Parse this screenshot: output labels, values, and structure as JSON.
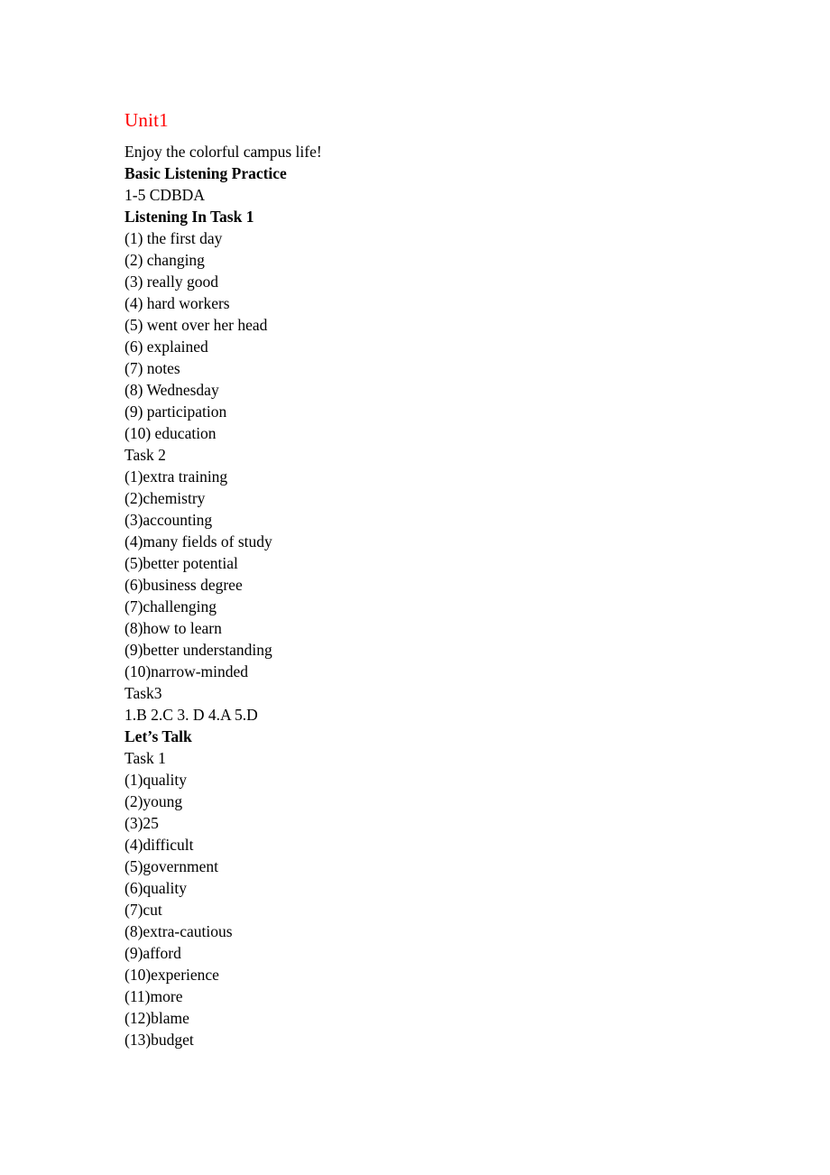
{
  "document": {
    "title": "Unit1",
    "title_color": "#ff0000",
    "body_color": "#000000",
    "background_color": "#ffffff",
    "intro": "Enjoy the colorful campus life!",
    "sections": [
      {
        "heading": "Basic Listening Practice",
        "heading_bold": true,
        "lines": [
          "1-5 CDBDA"
        ]
      },
      {
        "heading": "Listening In Task 1",
        "heading_bold": true,
        "lines": [
          "(1) the first day",
          "(2) changing",
          "(3) really good",
          "(4) hard workers",
          "(5) went over her head",
          "(6) explained",
          "(7) notes",
          "(8) Wednesday",
          "(9) participation",
          "(10) education"
        ]
      },
      {
        "heading": "Task 2",
        "heading_bold": false,
        "lines": [
          "(1)extra training",
          "(2)chemistry",
          "(3)accounting",
          "(4)many fields of study",
          "(5)better potential",
          "(6)business degree",
          "(7)challenging",
          "(8)how to learn",
          "(9)better understanding",
          "(10)narrow-minded"
        ]
      },
      {
        "heading": "Task3",
        "heading_bold": false,
        "lines": [
          "1.B 2.C 3. D 4.A 5.D"
        ]
      },
      {
        "heading": "Let’s Talk",
        "heading_bold": true,
        "lines": []
      },
      {
        "heading": "Task 1",
        "heading_bold": false,
        "lines": [
          "(1)quality",
          "(2)young",
          "(3)25",
          "(4)difficult",
          "(5)government",
          "(6)quality",
          "(7)cut",
          "(8)extra-cautious",
          "(9)afford",
          "(10)experience",
          "(11)more",
          "(12)blame",
          "(13)budget"
        ]
      }
    ]
  }
}
